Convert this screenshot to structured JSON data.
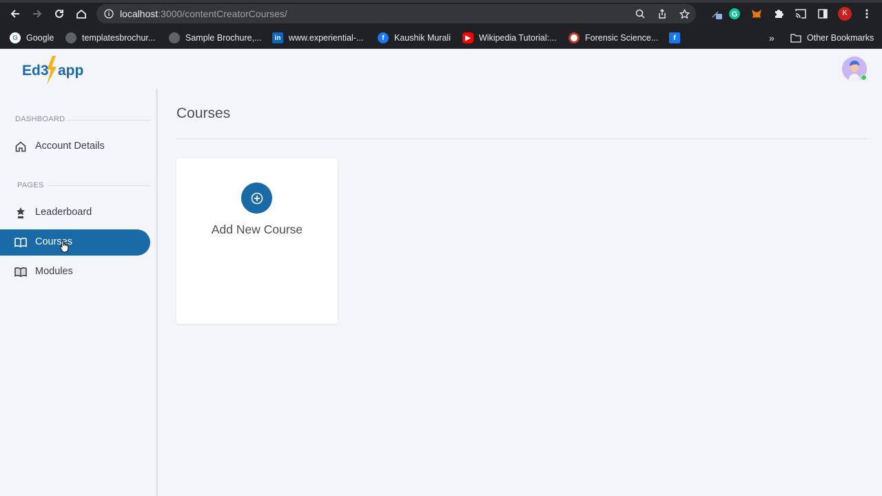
{
  "browser": {
    "url_host": "localhost",
    "url_path": ":3000/contentCreatorCourses/",
    "profile_initial": "K",
    "bookmarks": [
      {
        "label": "Google",
        "icon": "google-icon",
        "color": "#ffffff"
      },
      {
        "label": "templatesbrochur...",
        "icon": "globe-icon",
        "color": "#9aa0a6"
      },
      {
        "label": "Sample Brochure,...",
        "icon": "globe-icon",
        "color": "#9aa0a6"
      },
      {
        "label": "www.experiential-...",
        "icon": "linkedin-icon",
        "color": "#0a66c2"
      },
      {
        "label": "Kaushik Murali",
        "icon": "facebook-icon",
        "color": "#1877f2"
      },
      {
        "label": "Wikipedia Tutorial:...",
        "icon": "youtube-icon",
        "color": "#ff0000"
      },
      {
        "label": "Forensic Science...",
        "icon": "seal-icon",
        "color": "#c0392b"
      },
      {
        "label": "",
        "icon": "facebook-icon",
        "color": "#1877f2"
      }
    ],
    "overflow_label": "»",
    "other_bookmarks": "Other Bookmarks"
  },
  "app": {
    "logo_text": "Ed3Zapp",
    "sidebar": {
      "sections": [
        {
          "label": "DASHBOARD",
          "items": [
            {
              "label": "Account Details",
              "icon": "home-icon"
            }
          ]
        },
        {
          "label": "PAGES",
          "items": [
            {
              "label": "Leaderboard",
              "icon": "leaderboard-icon"
            },
            {
              "label": "Courses",
              "icon": "book-icon",
              "active": true
            },
            {
              "label": "Modules",
              "icon": "book-icon"
            }
          ]
        }
      ]
    },
    "main": {
      "title": "Courses",
      "add_card_label": "Add New Course"
    },
    "colors": {
      "accent": "#1b6aa8",
      "online": "#44c767"
    }
  }
}
